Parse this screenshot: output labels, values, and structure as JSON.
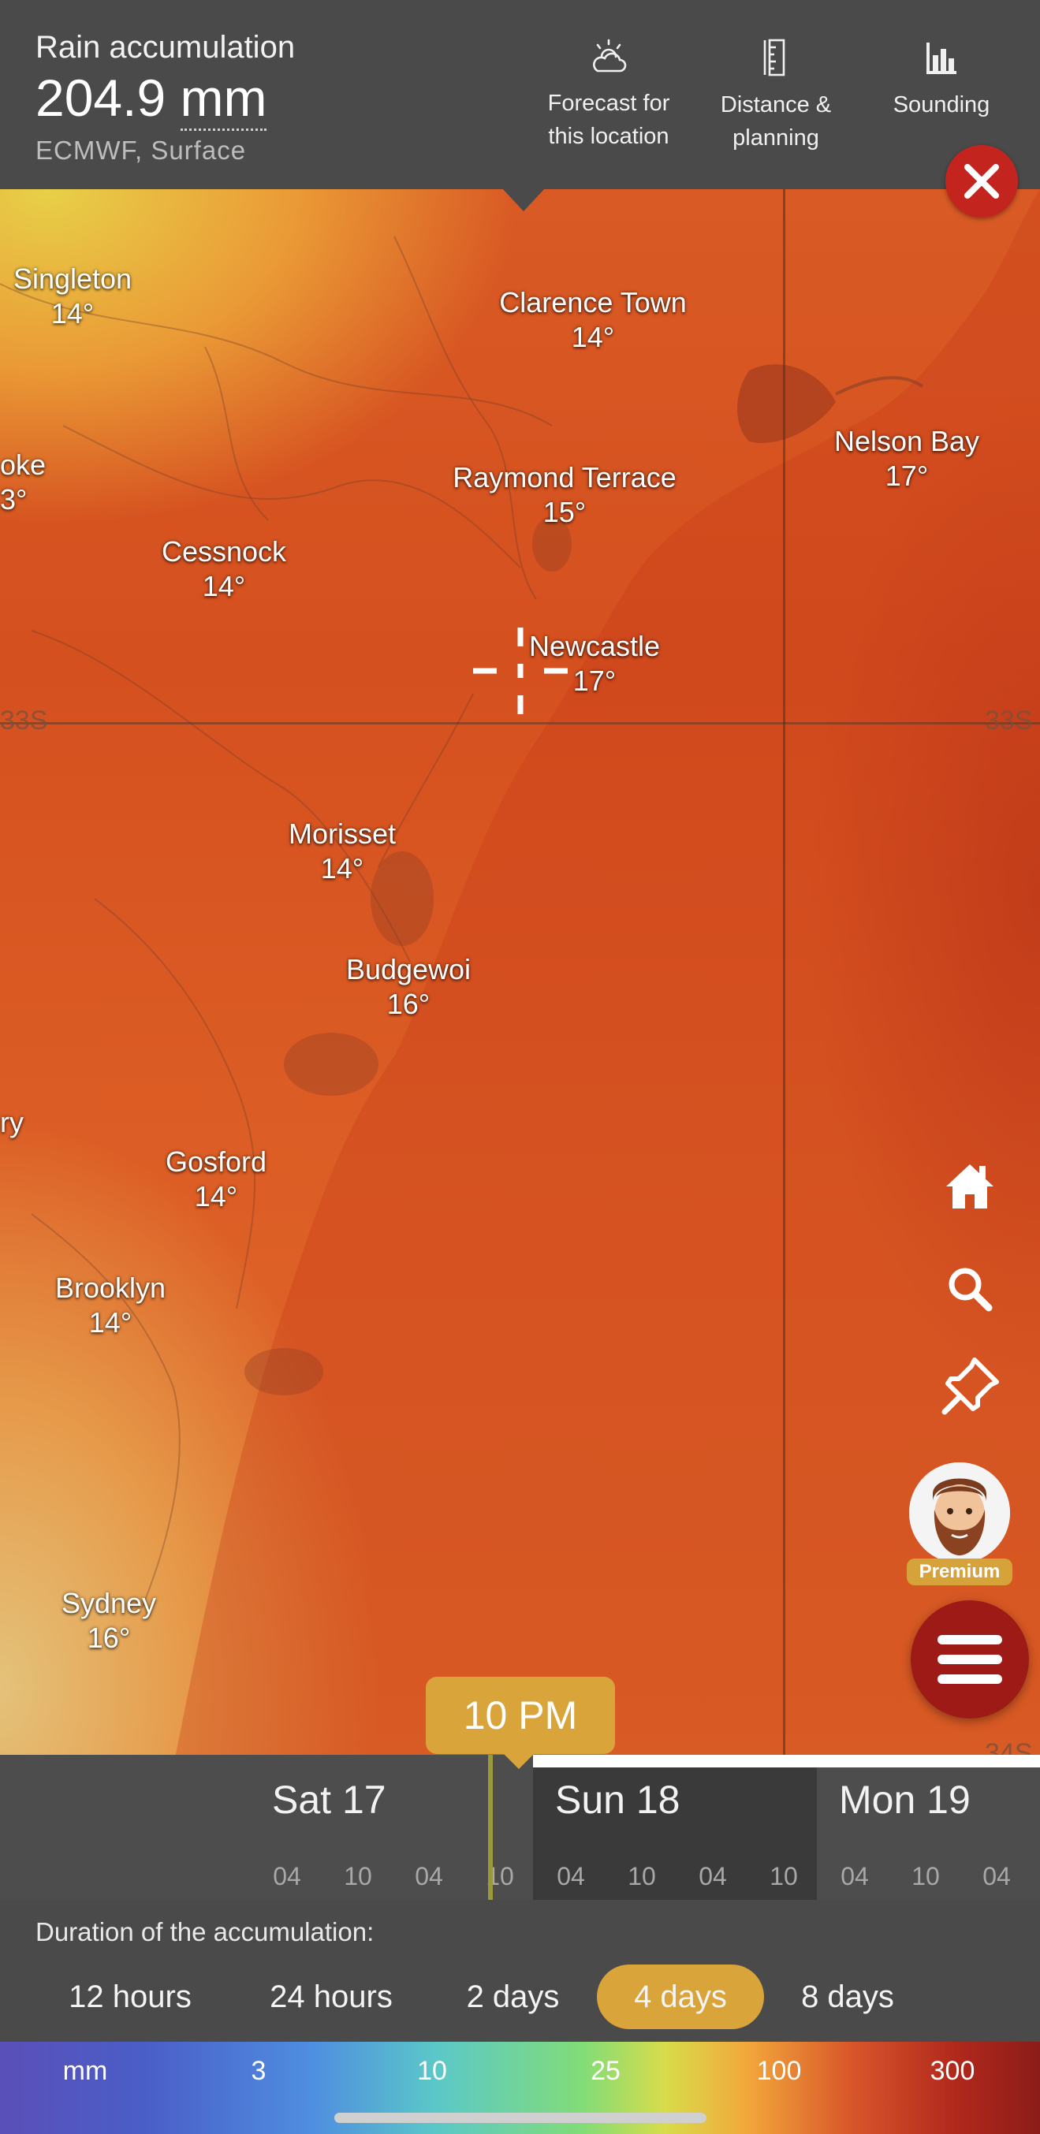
{
  "header": {
    "title": "Rain accumulation",
    "value_number": "204.9",
    "value_unit": "mm",
    "subtitle": "ECMWF, Surface",
    "actions": [
      {
        "label_line1": "Forecast for",
        "label_line2": "this location",
        "icon": "cloud-sun-icon"
      },
      {
        "label_line1": "Distance &",
        "label_line2": "planning",
        "icon": "ruler-icon"
      },
      {
        "label_line1": "Sounding",
        "label_line2": "",
        "icon": "bar-chart-icon"
      }
    ]
  },
  "map": {
    "cities": [
      {
        "name": "Singleton",
        "temp": "14°"
      },
      {
        "name": "Clarence Town",
        "temp": "14°"
      },
      {
        "name": "oke",
        "temp": "3°"
      },
      {
        "name": "Nelson Bay",
        "temp": "17°"
      },
      {
        "name": "Raymond Terrace",
        "temp": "15°"
      },
      {
        "name": "Cessnock",
        "temp": "14°"
      },
      {
        "name": "Newcastle",
        "temp": "17°"
      },
      {
        "name": "Morisset",
        "temp": "14°"
      },
      {
        "name": "Budgewoi",
        "temp": "16°"
      },
      {
        "name": "ry",
        "temp": ""
      },
      {
        "name": "Gosford",
        "temp": "14°"
      },
      {
        "name": "Brooklyn",
        "temp": "14°"
      },
      {
        "name": "Sydney",
        "temp": "16°"
      }
    ],
    "lat_label_left": "33S",
    "lat_label_right": "33S",
    "lat_label_bottom": "34S"
  },
  "side_buttons": {
    "home_icon": "home-icon",
    "search_icon": "search-icon",
    "pin_icon": "pin-icon",
    "premium_label": "Premium",
    "menu_icon": "hamburger-menu-icon",
    "close_icon": "close-icon"
  },
  "timeline": {
    "current_time": "10 PM",
    "days": [
      {
        "label": "Sat 17",
        "hours": [
          "04",
          "10",
          "04",
          "10"
        ]
      },
      {
        "label": "Sun 18",
        "hours": [
          "04",
          "10",
          "04",
          "10"
        ]
      },
      {
        "label": "Mon 19",
        "hours": [
          "04",
          "10",
          "04"
        ]
      }
    ]
  },
  "duration": {
    "label": "Duration of the accumulation:",
    "options": [
      "12 hours",
      "24 hours",
      "2 days",
      "4 days",
      "8 days"
    ],
    "selected": "4 days"
  },
  "legend": {
    "unit": "mm",
    "stops": [
      "3",
      "10",
      "25",
      "100",
      "300"
    ]
  },
  "colors": {
    "accent": "#d9a43a",
    "close_red": "#c3251e",
    "menu_red": "#9e1a16",
    "header_bg": "#4a4a4a"
  }
}
